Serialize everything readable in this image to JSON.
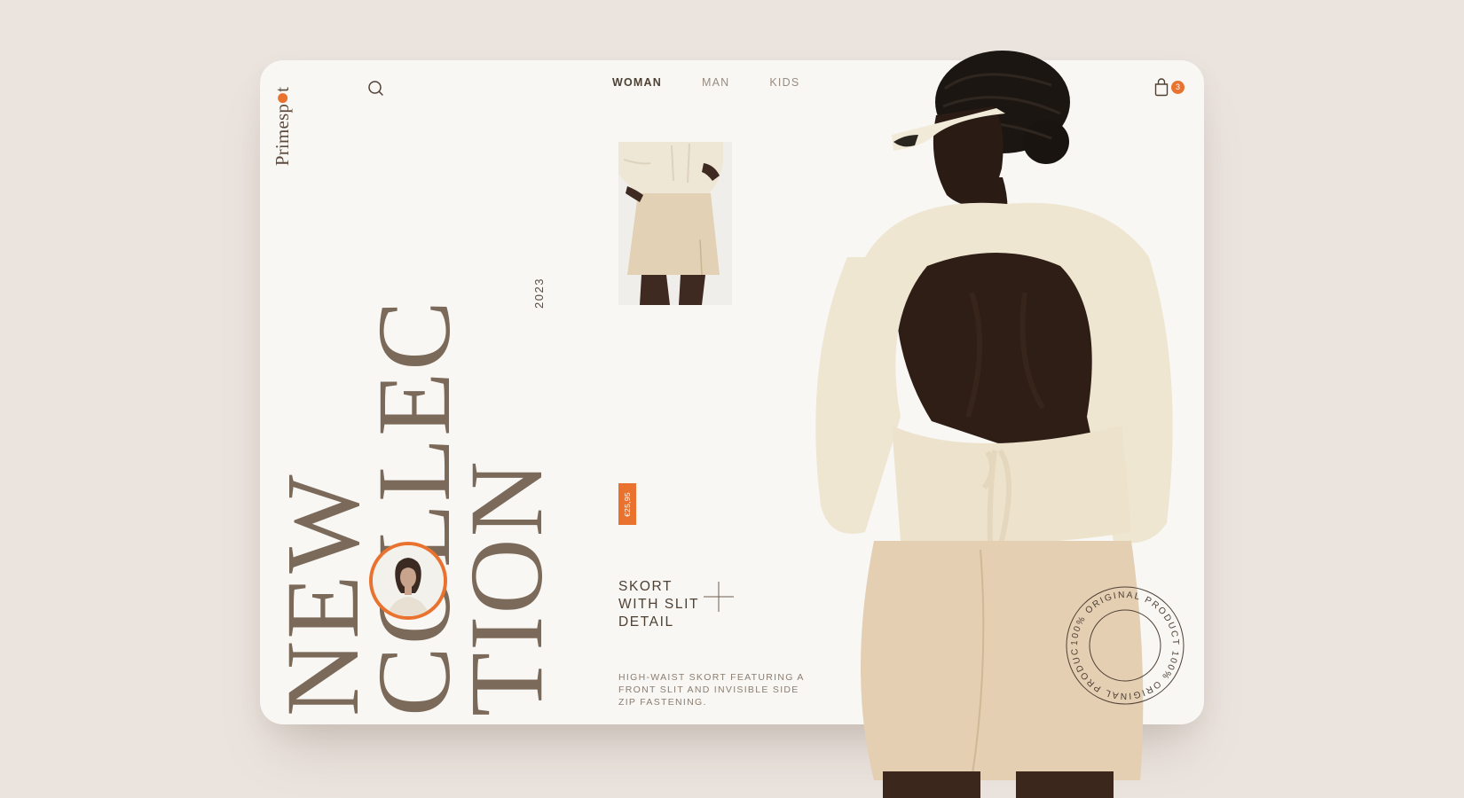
{
  "brand": {
    "name_part1": "Primesp",
    "name_part2": "t"
  },
  "nav": {
    "items": [
      {
        "label": "WOMAN",
        "active": true
      },
      {
        "label": "MAN",
        "active": false
      },
      {
        "label": "KIDS",
        "active": false
      }
    ]
  },
  "cart": {
    "count": "3"
  },
  "hero": {
    "line1": "NEW",
    "line2_start": "C",
    "line2_rest": "OLLEC",
    "line3": "TION",
    "year": "2023"
  },
  "product": {
    "price": "€25,95",
    "name_lines": [
      "SKORT",
      "WITH SLIT",
      "DETAIL"
    ],
    "description": "HIGH-WAIST SKORT FEATURING A FRONT SLIT AND INVISIBLE SIDE ZIP FASTENING."
  },
  "stamp": {
    "text": "100% ORIGINAL PRODUCT 100% ORIGINAL PRODUCT"
  },
  "colors": {
    "accent": "#e9722e",
    "text": "#6e5f51",
    "card": "#f8f7f4",
    "background": "#ebe4de"
  },
  "icons": {
    "search": "search-icon",
    "cart": "shopping-bag-icon",
    "add": "plus-icon"
  }
}
